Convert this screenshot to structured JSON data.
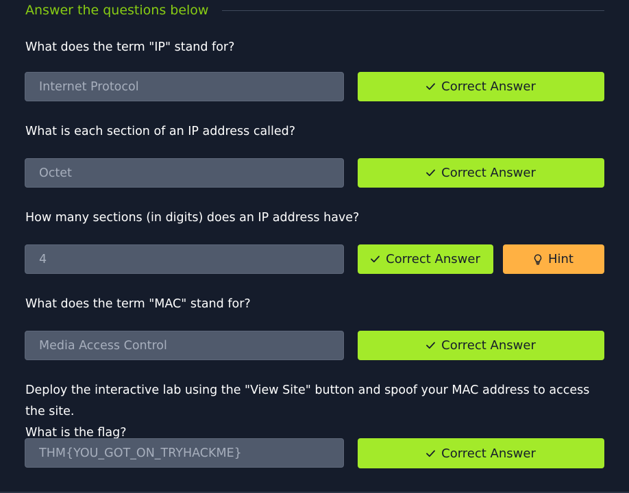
{
  "section": {
    "title": "Answer the questions below"
  },
  "questions": [
    {
      "text": "What does the term \"IP\" stand for?",
      "answer": "Internet Protocol",
      "button_label": "Correct Answer"
    },
    {
      "text": "What is each section of an IP address called?",
      "answer": "Octet",
      "button_label": "Correct Answer"
    },
    {
      "text": "How many sections (in digits) does an IP address have?",
      "answer": "4",
      "button_label": "Correct Answer",
      "hint_label": "Hint"
    },
    {
      "text": "What does the term \"MAC\" stand for?",
      "answer": "Media Access Control",
      "button_label": "Correct Answer"
    },
    {
      "text_line1": "Deploy the interactive lab using the \"View Site\" button and spoof your MAC address to access the site.",
      "text_line2": "What is the flag?",
      "answer": "THM{YOU_GOT_ON_TRYHACKME}",
      "button_label": "Correct Answer"
    }
  ],
  "icons": {
    "correct": "check-icon",
    "hint": "lightbulb-icon"
  },
  "colors": {
    "background": "#151c2b",
    "section_title": "#88cc14",
    "correct_button": "#a3ea2a",
    "hint_button": "#ffb143",
    "input_background": "#505a6c"
  }
}
